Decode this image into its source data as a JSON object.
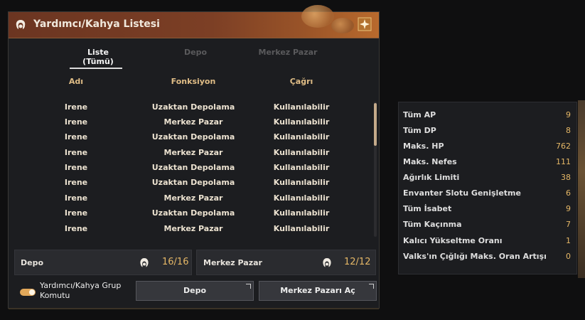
{
  "window": {
    "title": "Yardımcı/Kahya Listesi",
    "icons": {
      "title": "servant-head-icon",
      "emblem": "golden-emblem-icon"
    }
  },
  "tabs": [
    {
      "label": "Liste (Tümü)",
      "active": true
    },
    {
      "label": "Depo",
      "active": false
    },
    {
      "label": "Merkez Pazar",
      "active": false
    }
  ],
  "columns": {
    "name": "Adı",
    "function": "Fonksiyon",
    "call": "Çağrı"
  },
  "rows": [
    {
      "name": "Irene",
      "function": "Uzaktan Depolama",
      "call": "Kullanılabilir"
    },
    {
      "name": "Irene",
      "function": "Merkez Pazar",
      "call": "Kullanılabilir"
    },
    {
      "name": "Irene",
      "function": "Uzaktan Depolama",
      "call": "Kullanılabilir"
    },
    {
      "name": "Irene",
      "function": "Merkez Pazar",
      "call": "Kullanılabilir"
    },
    {
      "name": "Irene",
      "function": "Uzaktan Depolama",
      "call": "Kullanılabilir"
    },
    {
      "name": "Irene",
      "function": "Uzaktan Depolama",
      "call": "Kullanılabilir"
    },
    {
      "name": "Irene",
      "function": "Merkez Pazar",
      "call": "Kullanılabilir"
    },
    {
      "name": "Irene",
      "function": "Uzaktan Depolama",
      "call": "Kullanılabilir"
    },
    {
      "name": "Irene",
      "function": "Merkez Pazar",
      "call": "Kullanılabilir"
    }
  ],
  "footer": {
    "depo": {
      "label": "Depo",
      "count": "16/16"
    },
    "market": {
      "label": "Merkez Pazar",
      "count": "12/12"
    }
  },
  "toggle": {
    "label": "Yardımcı/Kahya Grup Komutu",
    "on": true
  },
  "buttons": {
    "depo": "Depo",
    "market": "Merkez Pazarı Aç"
  },
  "stats": [
    {
      "label": "Tüm AP",
      "value": "9"
    },
    {
      "label": "Tüm DP",
      "value": "8"
    },
    {
      "label": "Maks. HP",
      "value": "762"
    },
    {
      "label": "Maks. Nefes",
      "value": "111"
    },
    {
      "label": "Ağırlık Limiti",
      "value": "38"
    },
    {
      "label": "Envanter Slotu Genişletme",
      "value": "6"
    },
    {
      "label": "Tüm İsabet",
      "value": "9"
    },
    {
      "label": "Tüm Kaçınma",
      "value": "7"
    },
    {
      "label": "Kalıcı Yükseltme Oranı",
      "value": "1"
    },
    {
      "label": "Valks'ın Çığlığı Maks. Oran Artışı",
      "value": "0"
    }
  ],
  "colors": {
    "accent": "#e5b766",
    "header": "#e0bd86",
    "title_bar": "#7c3f25"
  }
}
